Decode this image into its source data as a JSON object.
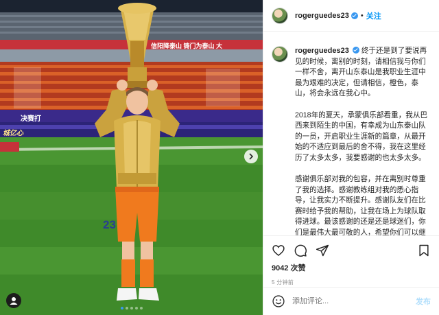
{
  "post": {
    "username": "rogerguedes23",
    "follow_label": "关注",
    "separator": "•",
    "caption_paragraphs": [
      "终于还是到了要说再见的时候，离别的时刻，请相信我与你们一样不舍，离开山东泰山是我职业生涯中最为艰难的决定，但请相信，橙色，泰山，将会永远在我心中。",
      "2018年的夏天，承蒙俱乐部看重，我从巴西来到陌生的中国，有幸成为山东泰山队的一员，开启职业生涯新的篇章，从最开始的不适应到最后的舍不得，我在这里经历了太多太多，我要感谢的也太多太多。",
      "感谢俱乐部对我的包容，并在离别时尊重了我的选择。感谢教练组对我的悉心指导，让我实力不断提升。感谢队友们在比赛时给予我的帮助，让我在场上为球队取得进球。最该感谢的还是还是球迷们，你们是最伟大最可敬的人，希望你们可以继续支持我，支持山东泰山"
    ],
    "likes": "9042 次赞",
    "timestamp": "5 分钟前",
    "comment_placeholder": "添加评论...",
    "post_button": "发布"
  },
  "photo": {
    "banner_text": "信阳降泰山 铸门为泰山 大",
    "board_text_left": "决赛打",
    "board_text_left2": "城亿心",
    "jersey_number": "23",
    "carousel_count": 5,
    "carousel_active": 0
  },
  "icons": {
    "like": "heart-icon",
    "comment": "comment-icon",
    "share": "share-icon",
    "save": "bookmark-icon",
    "emoji": "smiley-icon",
    "user_tag": "user-tag-icon",
    "next": "chevron-right-icon",
    "verified": "verified-badge-icon"
  },
  "colors": {
    "accent": "#0095f6",
    "verified": "#3897f0",
    "kit_orange": "#f07a1e",
    "gold_jacket": "#d8b24a",
    "pitch_green": "#3f8a2a"
  }
}
